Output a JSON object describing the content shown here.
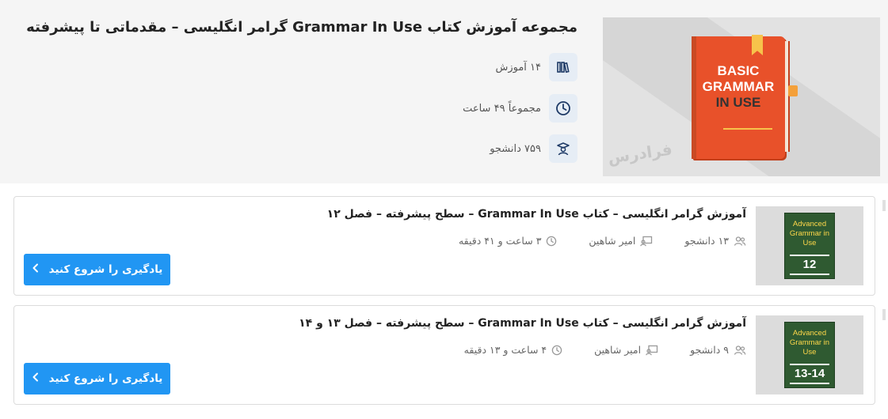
{
  "collection": {
    "title": "مجموعه آموزش کتاب Grammar In Use گرامر انگلیسی – مقدماتی تا پیشرفته",
    "cover": {
      "line1": "BASIC",
      "line2": "GRAMMAR",
      "line3": "IN USE",
      "watermark": "فرادرس"
    },
    "meta": [
      {
        "icon": "books-icon",
        "text": "۱۴ آموزش"
      },
      {
        "icon": "clock-icon",
        "text": "مجموعاً ۴۹ ساعت"
      },
      {
        "icon": "student-icon",
        "text": "۷۵۹ دانشجو"
      }
    ]
  },
  "courses": [
    {
      "title": "آموزش گرامر انگلیسی – کتاب Grammar In Use – سطح پیشرفته – فصل ۱۲",
      "students": "۱۳ دانشجو",
      "instructor": "امیر شاهین",
      "duration": "۳ ساعت و ۴۱ دقیقه",
      "thumb_title": "Advanced Grammar in Use",
      "thumb_number": "12",
      "button_label": "یادگیری را شروع کنید"
    },
    {
      "title": "آموزش گرامر انگلیسی – کتاب Grammar In Use – سطح پیشرفته – فصل ۱۳ و ۱۴",
      "students": "۹ دانشجو",
      "instructor": "امیر شاهین",
      "duration": "۴ ساعت و ۱۳ دقیقه",
      "thumb_title": "Advanced Grammar in Use",
      "thumb_number": "13-14",
      "button_label": "یادگیری را شروع کنید"
    }
  ],
  "colors": {
    "accent": "#2196f3",
    "book_orange": "#e8512a",
    "book_green": "#2f5a31",
    "thumb_yellow": "#ffd84a"
  }
}
